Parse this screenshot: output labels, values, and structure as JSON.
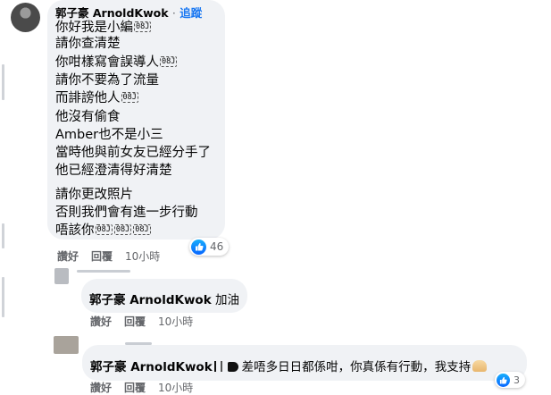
{
  "comment": {
    "author": "郭子豪 ArnoldKwok",
    "separator": "·",
    "follow_label": "追蹤",
    "lines": [
      {
        "text": "你好我是小編",
        "emoji": [
          "08J"
        ]
      },
      {
        "text": "請你查清楚",
        "emoji": []
      },
      {
        "text": "你咁樣寫會誤導人",
        "emoji": [
          "08J"
        ]
      },
      {
        "text": "請你不要為了流量",
        "emoji": []
      },
      {
        "text": "而誹謗他人",
        "emoji": [
          "08J"
        ]
      },
      {
        "text": "他沒有偷食",
        "emoji": []
      },
      {
        "text": "Amber也不是小三",
        "emoji": []
      },
      {
        "text": "當時他與前女友已經分手了",
        "emoji": []
      },
      {
        "text": "他已經澄清得好清楚",
        "emoji": []
      },
      {
        "text": "請你更改照片",
        "emoji": []
      },
      {
        "text": "否則我們會有進一步行動",
        "emoji": []
      },
      {
        "text": "唔該你",
        "emoji": [
          "08J",
          "08J",
          "08J"
        ]
      }
    ],
    "actions": {
      "like": "讚好",
      "reply": "回覆",
      "time": "10小時"
    },
    "reaction_count": "46",
    "reaction_icon": "like-icon"
  },
  "reply1": {
    "author": "郭子豪 ArnoldKwok",
    "text": "加油",
    "actions": {
      "like": "讚好",
      "reply": "回覆",
      "time": "10小時"
    }
  },
  "reply2": {
    "author": "郭子豪 ArnoldKwok",
    "text": "差唔多日日都係咁，你真係有行動，我支持",
    "reaction_count": "3",
    "actions": {
      "like": "讚好",
      "reply": "回覆",
      "time": "10小時"
    }
  },
  "colors": {
    "bubble": "#f0f2f5",
    "link": "#1877f2",
    "meta": "#65676b",
    "like": "#0866ff"
  }
}
